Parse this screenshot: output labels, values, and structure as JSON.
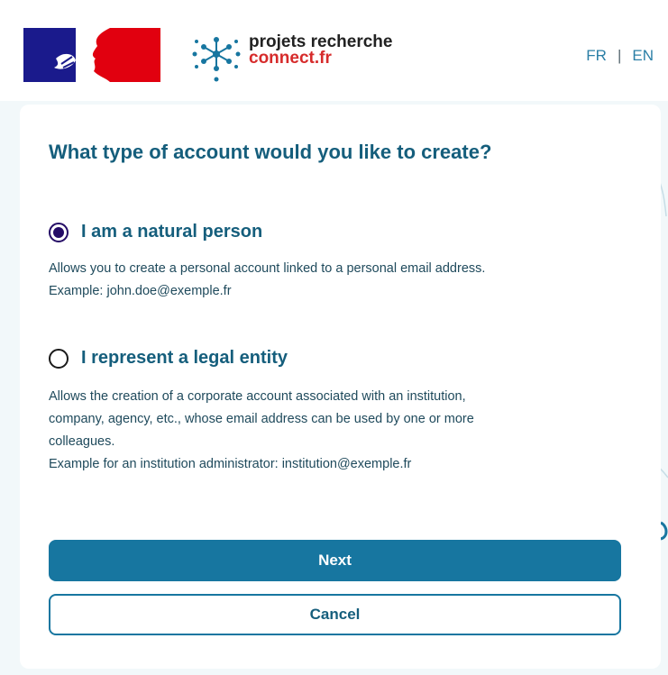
{
  "header": {
    "logo_line1": "projets recherche",
    "logo_line2": "connect.fr",
    "lang_fr": "FR",
    "lang_sep": "|",
    "lang_en": "EN"
  },
  "form": {
    "title": "What type of account would you like to create?",
    "options": [
      {
        "label": "I am a natural person",
        "checked": true,
        "desc_lines": [
          "Allows you to create a personal account linked to a personal email address.",
          "Example: john.doe@exemple.fr"
        ]
      },
      {
        "label": "I represent a legal entity",
        "checked": false,
        "desc_lines": [
          "Allows the creation of a corporate account associated with an institution,",
          "company, agency, etc., whose email address can be used by one or more",
          "colleagues.",
          "Example for an institution administrator: institution@exemple.fr"
        ]
      }
    ],
    "next_label": "Next",
    "cancel_label": "Cancel"
  },
  "colors": {
    "primary": "#1776a0",
    "title": "#155e7c",
    "radio_selected": "#240b66",
    "french_blue": "#1a1a8c",
    "french_red": "#e1000f",
    "background": "#f2f8fa"
  },
  "icons": [
    "marianne-logo",
    "snowflake-network-icon"
  ]
}
